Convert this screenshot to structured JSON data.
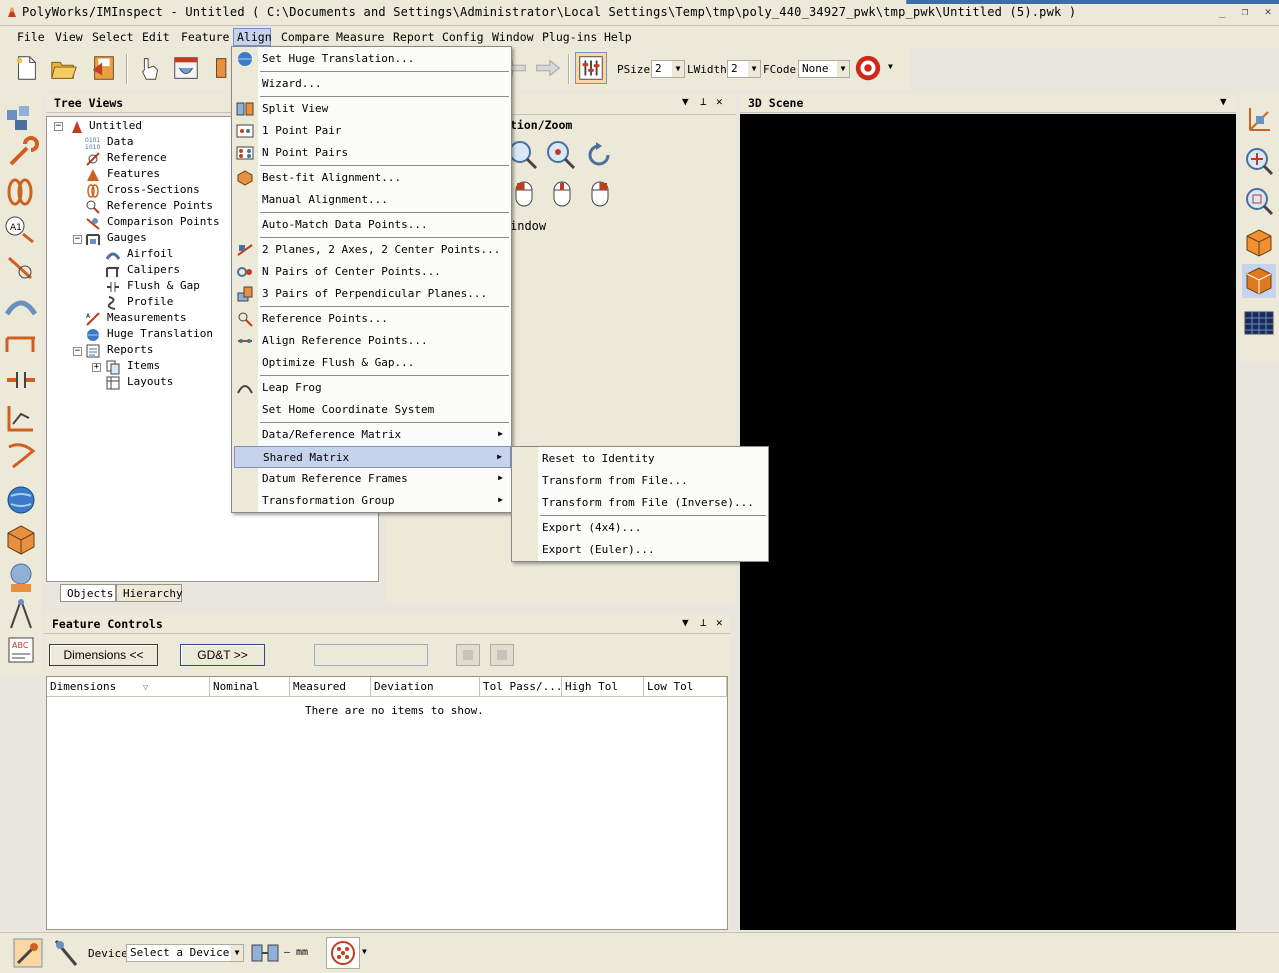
{
  "window": {
    "title": "PolyWorks/IMInspect - Untitled ( C:\\Documents and Settings\\Administrator\\Local Settings\\Temp\\tmp\\poly_440_34927_pwk\\tmp_pwk\\Untitled (5).pwk )",
    "minimize": "_",
    "restore": "❐",
    "close": "✕"
  },
  "menubar": {
    "items": [
      "File",
      "View",
      "Select",
      "Edit",
      "Feature",
      "Align",
      "Compare",
      "Measure",
      "Report",
      "Config",
      "Window",
      "Plug-ins",
      "Help"
    ],
    "active": "Align"
  },
  "toolbar": {
    "psize_label": "PSize",
    "psize_value": "2",
    "lwidth_label": "LWidth",
    "lwidth_value": "2",
    "fcode_label": "FCode",
    "fcode_value": "None"
  },
  "tree_views": {
    "title": "Tree Views",
    "nodes": [
      {
        "label": "Untitled"
      },
      {
        "label": "Data"
      },
      {
        "label": "Reference"
      },
      {
        "label": "Features"
      },
      {
        "label": "Cross-Sections"
      },
      {
        "label": "Reference Points"
      },
      {
        "label": "Comparison Points"
      },
      {
        "label": "Gauges"
      },
      {
        "label": "Airfoil"
      },
      {
        "label": "Calipers"
      },
      {
        "label": "Flush & Gap"
      },
      {
        "label": "Profile"
      },
      {
        "label": "Measurements"
      },
      {
        "label": "Huge Translation"
      },
      {
        "label": "Reports"
      },
      {
        "label": "Items"
      },
      {
        "label": "Layouts"
      }
    ],
    "tabs": [
      "Objects",
      "Hierarchy"
    ]
  },
  "camera_panel": {
    "title_fragment": "tion/Zoom",
    "window_fragment": "indow"
  },
  "scene": {
    "title": "3D Scene",
    "background": "#000000"
  },
  "feature_controls": {
    "title": "Feature Controls",
    "dimensions_button": "Dimensions <<",
    "gdt_button": "GD&T >>",
    "columns": [
      "Dimensions",
      "Nominal",
      "Measured",
      "Deviation",
      "Tol Pass/...",
      "High Tol",
      "Low Tol"
    ],
    "empty_text": "There are no items to show."
  },
  "statusbar": {
    "device_label": "Device",
    "device_value": "Select a Device",
    "unit_text": "— mm"
  },
  "align_menu": {
    "items": [
      "Set Huge Translation...",
      "Wizard...",
      "Split View",
      "1 Point Pair",
      "N Point Pairs",
      "Best-fit Alignment...",
      "Manual Alignment...",
      "Auto-Match Data Points...",
      "2 Planes, 2 Axes, 2 Center Points...",
      "N Pairs of Center Points...",
      "3 Pairs of Perpendicular Planes...",
      "Reference Points...",
      "Align Reference Points...",
      "Optimize Flush & Gap...",
      "Leap Frog",
      "Set Home Coordinate System",
      "Data/Reference Matrix",
      "Shared Matrix",
      "Datum Reference Frames",
      "Transformation Group"
    ],
    "highlighted": "Shared Matrix"
  },
  "shared_matrix_menu": {
    "items": [
      "Reset to Identity",
      "Transform from File...",
      "Transform from File (Inverse)...",
      "Export (4x4)...",
      "Export (Euler)..."
    ]
  },
  "colors": {
    "menu_highlight": "#c6d3ec",
    "chrome": "#ece9d8"
  }
}
